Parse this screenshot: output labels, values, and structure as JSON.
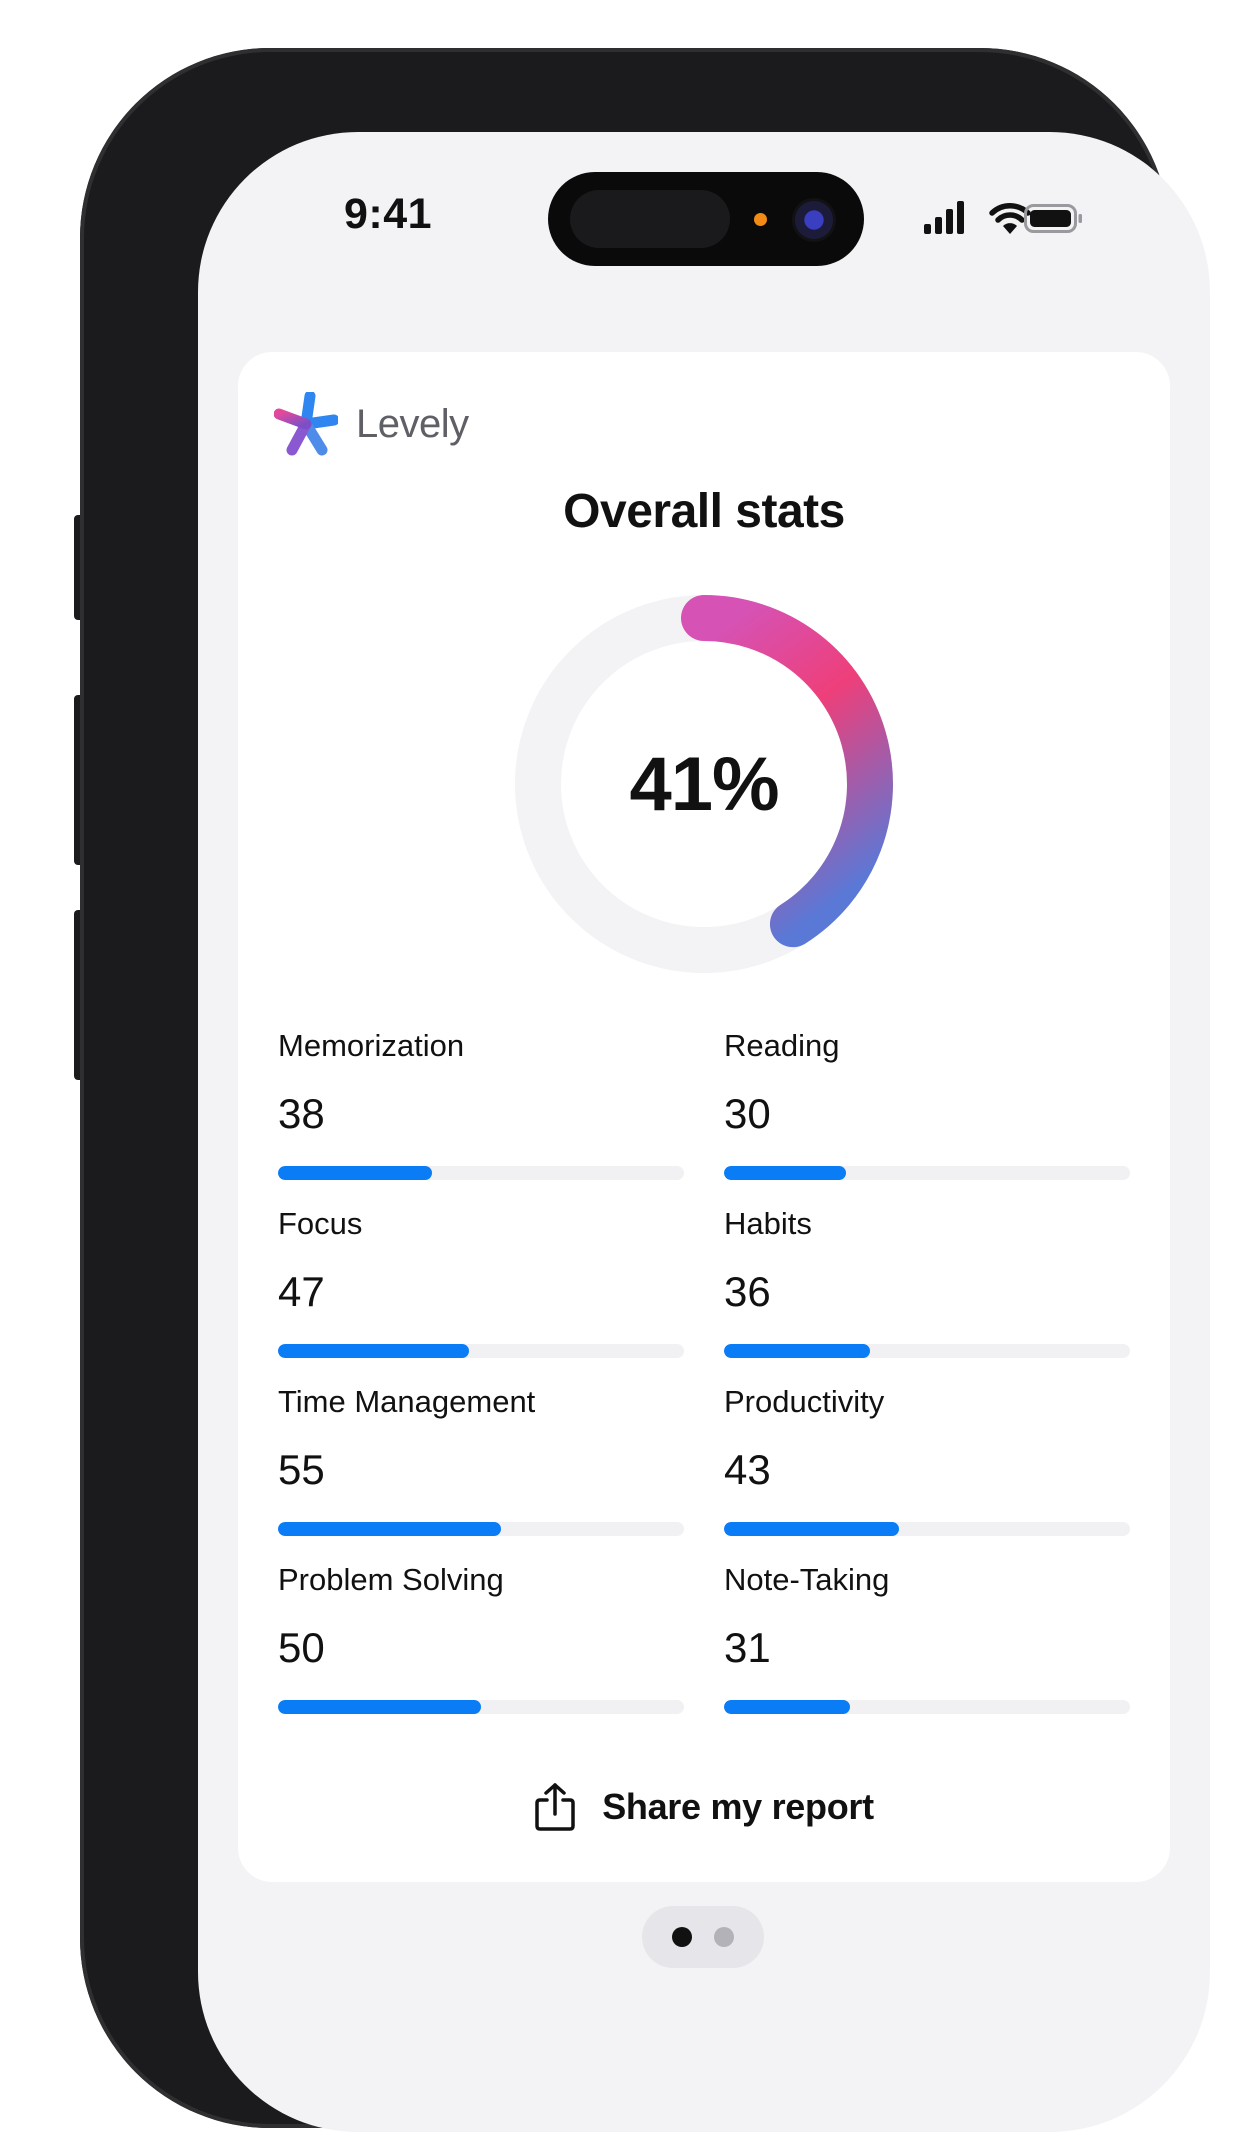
{
  "status_bar": {
    "time": "9:41"
  },
  "app": {
    "name": "Levely"
  },
  "overview": {
    "title": "Overall stats",
    "overall_percent": 41,
    "overall_label": "41%"
  },
  "stats": [
    {
      "label": "Memorization",
      "value": "38",
      "fraction": 0.38
    },
    {
      "label": "Reading",
      "value": "30",
      "fraction": 0.3
    },
    {
      "label": "Focus",
      "value": "47",
      "fraction": 0.47
    },
    {
      "label": "Habits",
      "value": "36",
      "fraction": 0.36
    },
    {
      "label": "Time Management",
      "value": "55",
      "fraction": 0.55
    },
    {
      "label": "Productivity",
      "value": "43",
      "fraction": 0.43
    },
    {
      "label": "Problem Solving",
      "value": "50",
      "fraction": 0.5
    },
    {
      "label": "Note-Taking",
      "value": "31",
      "fraction": 0.31
    }
  ],
  "share": {
    "label": "Share my report",
    "icon": "share-icon"
  },
  "pager": {
    "pages": 2,
    "active": 1
  },
  "colors": {
    "bar": "#0a7cf5",
    "track": "#f1f1f3",
    "gradient_start": "#d652b4",
    "gradient_mid": "#ee3f7a",
    "gradient_end": "#5a78d6"
  }
}
